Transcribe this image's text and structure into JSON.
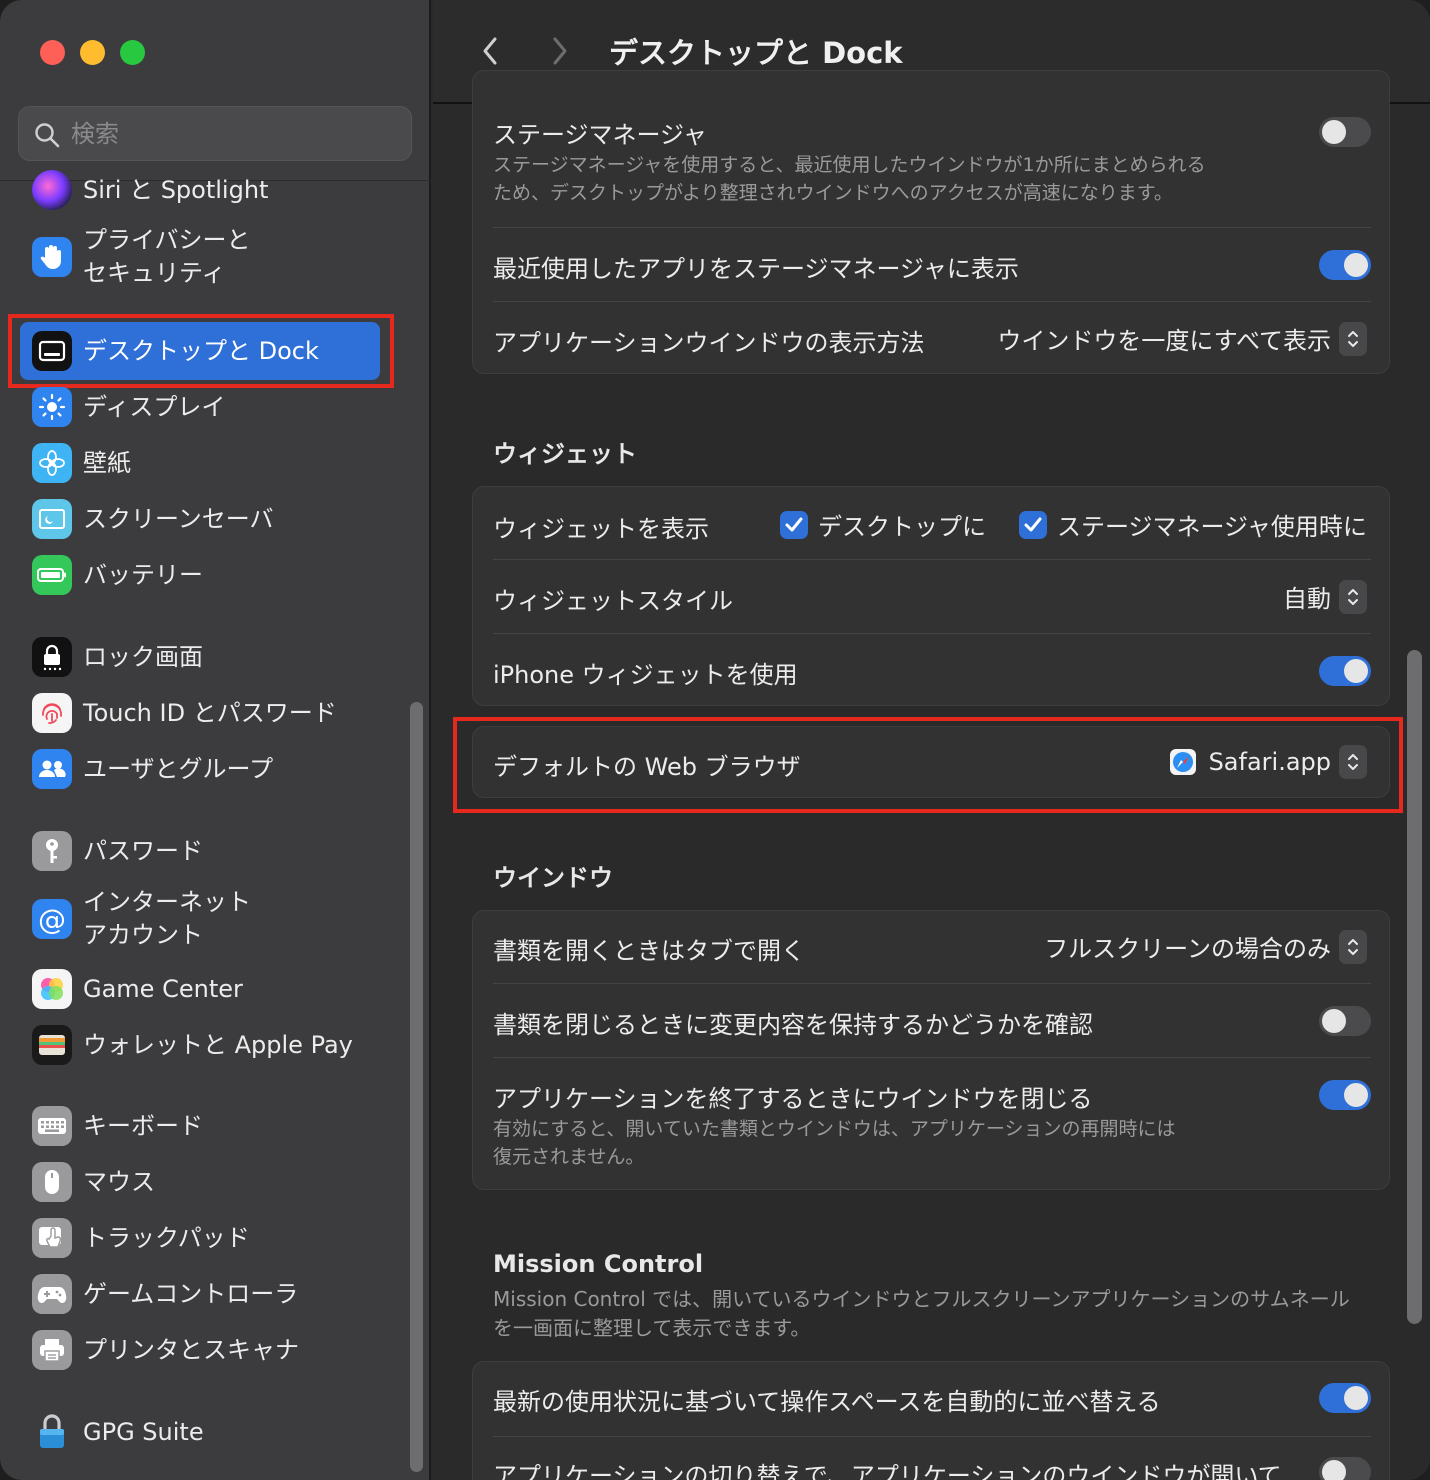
{
  "window": {
    "title": "デスクトップと Dock"
  },
  "search": {
    "placeholder": "検索"
  },
  "sidebar": {
    "items": [
      {
        "label": "Siri と Spotlight",
        "icon": "siri-icon"
      },
      {
        "label": "プライバシーと\nセキュリティ",
        "icon": "hand-icon"
      },
      {
        "label": "デスクトップと Dock",
        "icon": "dock-icon",
        "selected": true
      },
      {
        "label": "ディスプレイ",
        "icon": "sun-icon"
      },
      {
        "label": "壁紙",
        "icon": "flower-icon"
      },
      {
        "label": "スクリーンセーバ",
        "icon": "screensaver-icon"
      },
      {
        "label": "バッテリー",
        "icon": "battery-icon"
      },
      {
        "label": "ロック画面",
        "icon": "lock-icon"
      },
      {
        "label": "Touch ID とパスワード",
        "icon": "fingerprint-icon"
      },
      {
        "label": "ユーザとグループ",
        "icon": "users-icon"
      },
      {
        "label": "パスワード",
        "icon": "key-icon"
      },
      {
        "label": "インターネット\nアカウント",
        "icon": "at-icon"
      },
      {
        "label": "Game Center",
        "icon": "game-center-icon"
      },
      {
        "label": "ウォレットと Apple Pay",
        "icon": "wallet-icon"
      },
      {
        "label": "キーボード",
        "icon": "keyboard-icon"
      },
      {
        "label": "マウス",
        "icon": "mouse-icon"
      },
      {
        "label": "トラックパッド",
        "icon": "trackpad-icon"
      },
      {
        "label": "ゲームコントローラ",
        "icon": "gamepad-icon"
      },
      {
        "label": "プリンタとスキャナ",
        "icon": "printer-icon"
      },
      {
        "label": "GPG Suite",
        "icon": "gpg-lock-icon"
      }
    ]
  },
  "stage_manager": {
    "label": "ステージマネージャ",
    "desc_line1": "ステージマネージャを使用すると、最近使用したウインドウが1か所にまとめられる",
    "desc_line2": "ため、デスクトップがより整理されウインドウへのアクセスが高速になります。",
    "enabled": false,
    "recent_apps_label": "最近使用したアプリをステージマネージャに表示",
    "recent_apps_enabled": true,
    "app_windows_label": "アプリケーションウインドウの表示方法",
    "app_windows_value": "ウインドウを一度にすべて表示"
  },
  "widgets": {
    "section_title": "ウィジェット",
    "show_label": "ウィジェットを表示",
    "on_desktop_label": "デスクトップに",
    "on_desktop_checked": true,
    "in_stage_label": "ステージマネージャ使用時に",
    "in_stage_checked": true,
    "style_label": "ウィジェットスタイル",
    "style_value": "自動",
    "iphone_label": "iPhone ウィジェットを使用",
    "iphone_enabled": true
  },
  "browser": {
    "label": "デフォルトの Web ブラウザ",
    "value": "Safari.app",
    "icon": "safari-icon"
  },
  "windows": {
    "section_title": "ウインドウ",
    "tabs_label": "書類を開くときはタブで開く",
    "tabs_value": "フルスクリーンの場合のみ",
    "ask_keep_label": "書類を閉じるときに変更内容を保持するかどうかを確認",
    "ask_keep_enabled": false,
    "close_windows_label": "アプリケーションを終了するときにウインドウを閉じる",
    "close_windows_enabled": true,
    "close_desc_line1": "有効にすると、開いていた書類とウインドウは、アプリケーションの再開時には",
    "close_desc_line2": "復元されません。"
  },
  "mission_control": {
    "section_title": "Mission Control",
    "desc_line1": "Mission Control では、開いているウインドウとフルスクリーンアプリケーションのサムネール",
    "desc_line2": "を一画面に整理して表示できます。",
    "rearrange_label": "最新の使用状況に基づいて操作スペースを自動的に並べ替える",
    "rearrange_enabled": true,
    "switch_label": "アプリケーションの切り替えで、アプリケーションのウインドウが開いて",
    "switch_enabled": false
  },
  "colors": {
    "accent": "#2f6fd8",
    "highlight": "#e6291e",
    "sidebar_bg": "#3c3c3e",
    "main_bg": "#2a2a2a"
  }
}
